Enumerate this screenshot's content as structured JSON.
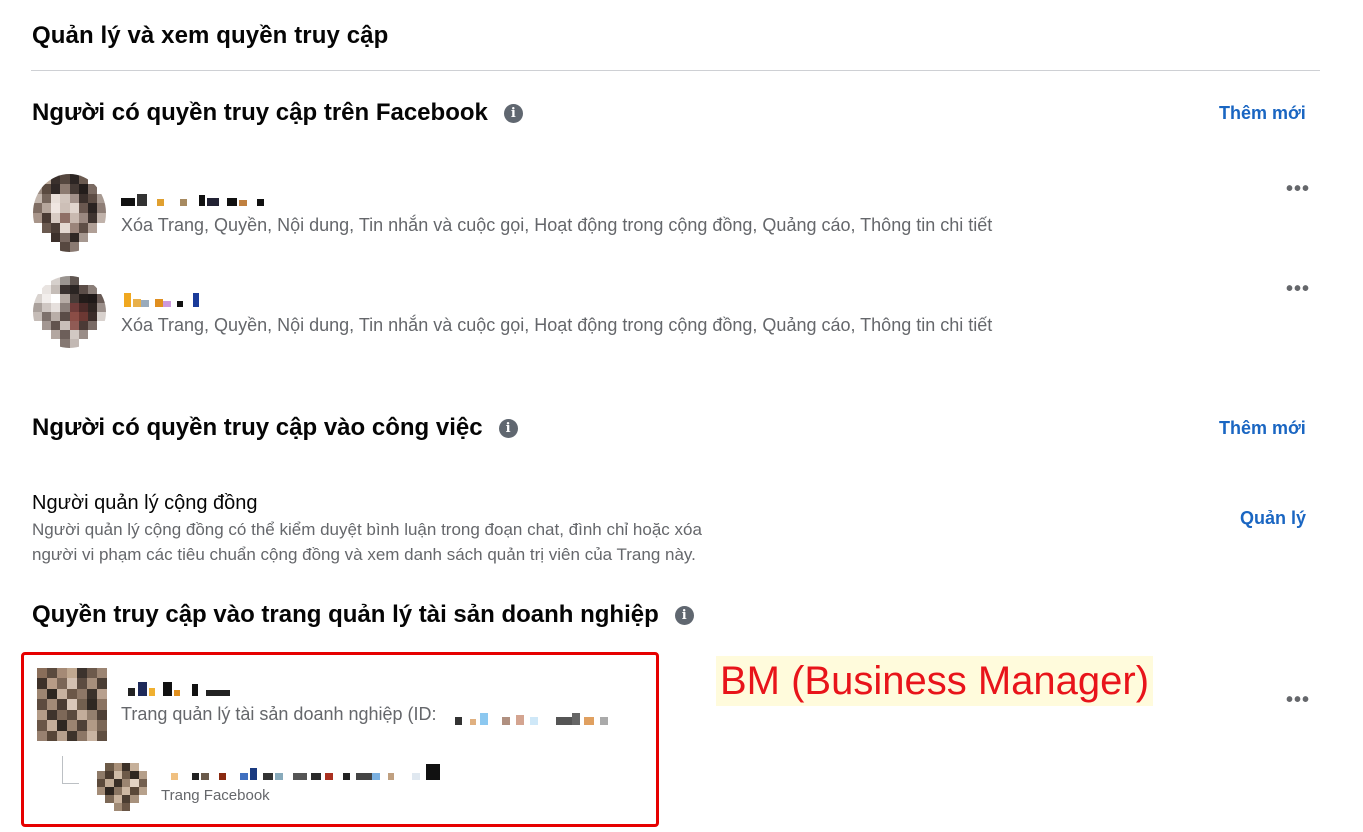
{
  "page": {
    "title": "Quản lý và xem quyền truy cập"
  },
  "facebook_access": {
    "title": "Người có quyền truy cập trên Facebook",
    "add_label": "Thêm mới",
    "people": [
      {
        "permissions": "Xóa Trang, Quyền, Nội dung, Tin nhắn và cuộc gọi, Hoạt động trong cộng đồng, Quảng cáo, Thông tin chi tiết",
        "more_label": "•••"
      },
      {
        "permissions": "Xóa Trang, Quyền, Nội dung, Tin nhắn và cuộc gọi, Hoạt động trong cộng đồng, Quảng cáo, Thông tin chi tiết",
        "more_label": "•••"
      }
    ]
  },
  "task_access": {
    "title": "Người có quyền truy cập vào công việc",
    "add_label": "Thêm mới",
    "community_manager": {
      "title": "Người quản lý cộng đồng",
      "description_line1": "Người quản lý cộng đồng có thể kiểm duyệt bình luận trong đoạn chat, đình chỉ hoặc xóa",
      "description_line2": "người vi phạm các tiêu chuẩn cộng đồng và xem danh sách quản trị viên của Trang này.",
      "manage_label": "Quản lý"
    }
  },
  "business_access": {
    "title": "Quyền truy cập vào trang quản lý tài sản doanh nghiệp",
    "business": {
      "subtitle": "Trang quản lý tài sản doanh nghiệp (ID:",
      "more_label": "•••"
    },
    "page_item": {
      "subtitle": "Trang Facebook"
    }
  },
  "annotation": {
    "label": "BM (Business Manager)"
  },
  "icons": {
    "info": "info-icon",
    "more": "more-options-icon"
  },
  "colors": {
    "link": "#1a66c2",
    "secondary_text": "#65676b",
    "info_icon": "#606770",
    "highlight_border": "#e60000",
    "annotation_text": "#e8141a",
    "annotation_bg": "#fffbdc"
  }
}
